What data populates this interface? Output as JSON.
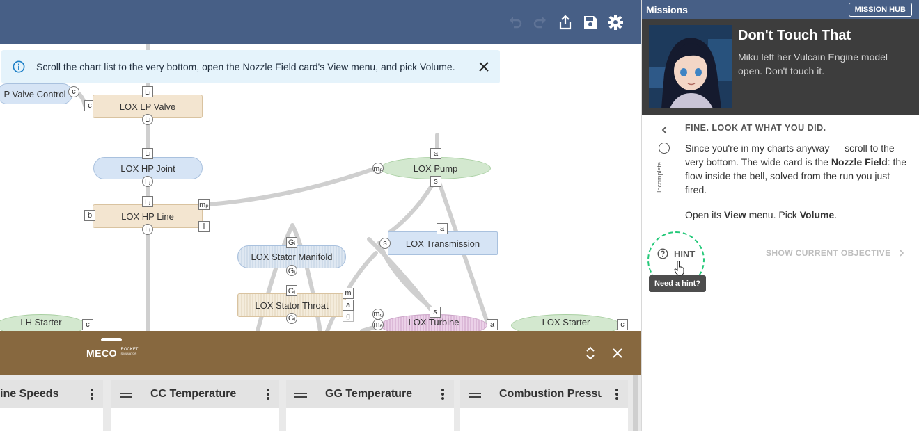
{
  "toolbar": {
    "icons": [
      "undo-icon",
      "redo-icon",
      "share-icon",
      "save-icon",
      "gear-icon"
    ]
  },
  "toast": {
    "message": "Scroll the chart list to the very bottom, open the Nozzle Field card's View menu, and pick Volume."
  },
  "canvas": {
    "nodes": {
      "lh_valve_control": "P Valve Control",
      "lox_lp_valve": "LOX LP Valve",
      "lox_hp_joint": "LOX HP Joint",
      "lox_hp_line": "LOX HP Line",
      "lox_pump": "LOX Pump",
      "lox_transmission": "LOX Transmission",
      "lox_stator_manifold": "LOX Stator Manifold",
      "lox_stator_throat": "LOX Stator Throat",
      "lox_turbine": "LOX Turbine",
      "lh_starter": "LH Starter",
      "lox_starter": "LOX Starter"
    },
    "ports": {
      "c": "c",
      "b": "b",
      "l": "l",
      "a": "a",
      "s": "s",
      "m": "m",
      "g": "g",
      "Li": "Lᵢ",
      "Lj": "Lⱼ",
      "Gi": "Gᵢ",
      "Gj": "Gⱼ",
      "mp": "mₚ",
      "mo": "mₒ",
      "ma": "mₐ"
    }
  },
  "bottom_panel": {
    "logo_main": "MECO",
    "logo_top": "ROCKET",
    "logo_bottom": "SIMULATOR",
    "cards": [
      {
        "title": "ine Speeds"
      },
      {
        "title": "CC Temperature"
      },
      {
        "title": "GG Temperature"
      },
      {
        "title": "Combustion Pressure"
      }
    ]
  },
  "sidebar": {
    "header_title": "Missions",
    "hub_button": "MISSION HUB",
    "mission": {
      "title": "Don't Touch That",
      "description": "Miku left her Vulcain Engine model open. Don't touch it."
    },
    "status_label": "Incomplete",
    "objective": {
      "title": "FINE. LOOK AT WHAT YOU DID.",
      "p1_a": "Since you're in my charts anyway — scroll to the very bottom. The wide card is the ",
      "p1_b": "Nozzle Field",
      "p1_c": ": the flow inside the bell, solved from the run you just fired.",
      "p2_a": "Open its ",
      "p2_b": "View",
      "p2_c": " menu. Pick ",
      "p2_d": "Volume",
      "p2_e": "."
    },
    "hint_button": "HINT",
    "hint_tooltip": "Need a hint?",
    "show_objective": "SHOW CURRENT OBJECTIVE"
  }
}
